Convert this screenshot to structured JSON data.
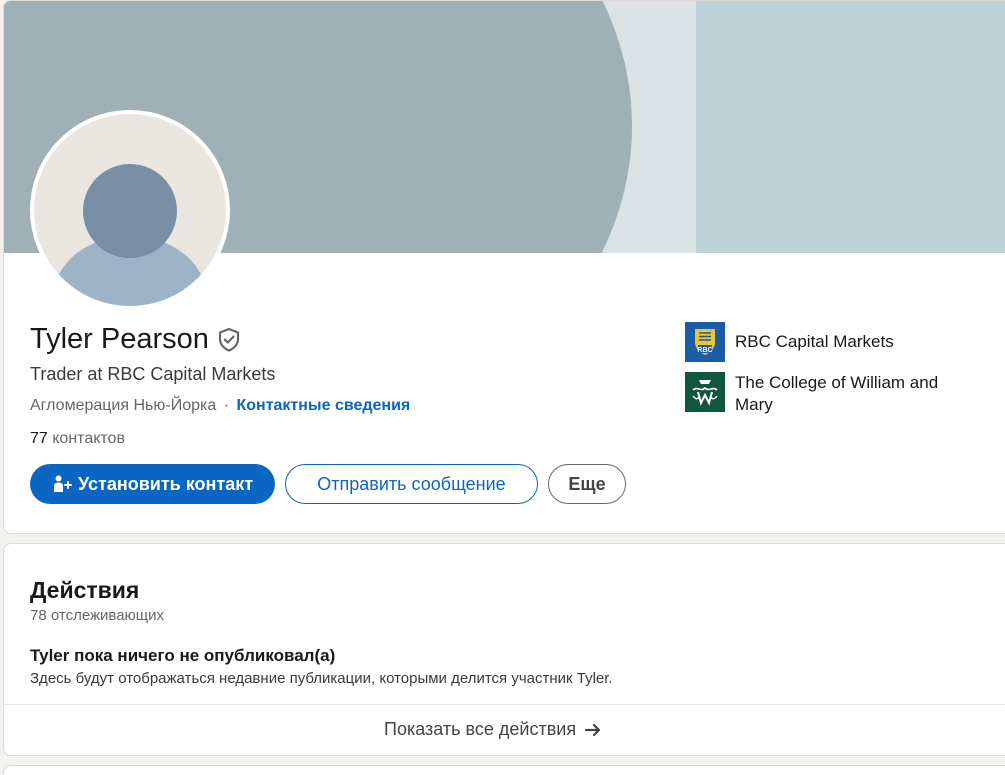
{
  "profile": {
    "name": "Tyler Pearson",
    "headline": "Trader at RBC Capital Markets",
    "location": "Агломерация Нью-Йорка",
    "location_separator": "·",
    "contact_info_link": "Контактные сведения",
    "connections_count": "77",
    "connections_label": "контактов",
    "icons": {
      "verify": "shield-check-icon",
      "connect": "add-person-icon"
    }
  },
  "actions": {
    "connect_label": "Установить контакт",
    "message_label": "Отправить сообщение",
    "more_label": "Еще"
  },
  "organizations": [
    {
      "name": "RBC Capital Markets",
      "logo": "rbc-logo",
      "logo_text": "RBC"
    },
    {
      "name": "The College of William and Mary",
      "logo": "william-and-mary-logo"
    }
  ],
  "activity": {
    "title": "Действия",
    "followers": "78 отслеживающих",
    "empty_title": "Tyler пока ничего не опубликовал(а)",
    "empty_description": "Здесь будут отображаться недавние публикации, которыми делится участник Tyler.",
    "show_all_label": "Показать все действия",
    "show_all_icon": "arrow-right-icon"
  },
  "colors": {
    "accent": "#0a66c2",
    "banner": "#9fb1b6",
    "background": "#f4f2ee"
  }
}
